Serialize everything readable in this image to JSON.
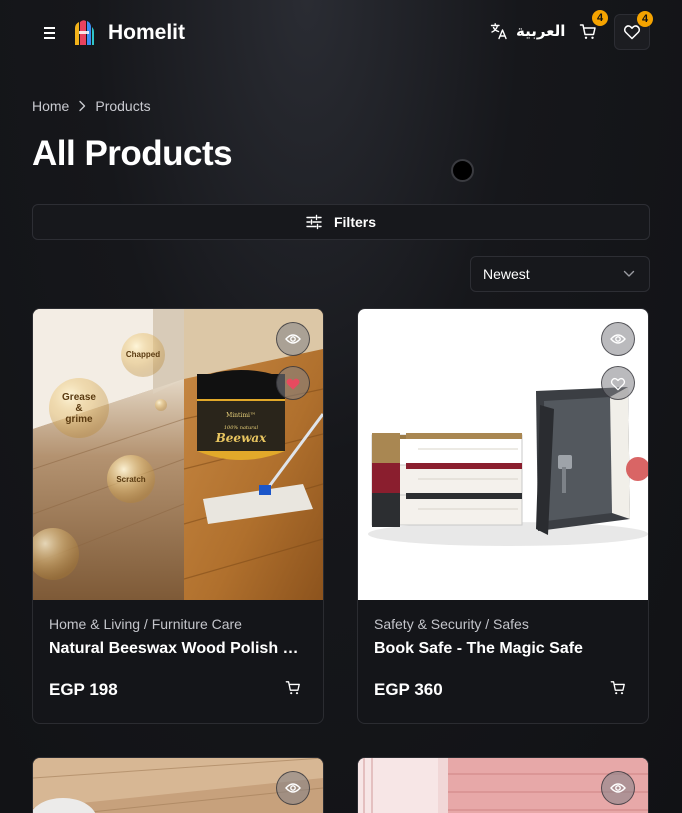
{
  "header": {
    "brand": "Homelit",
    "language_label": "العربية",
    "cart_count": "4",
    "wishlist_count": "4"
  },
  "breadcrumb": {
    "home": "Home",
    "current": "Products"
  },
  "page_title": "All Products",
  "filters_label": "Filters",
  "sort": {
    "selected": "Newest"
  },
  "products": [
    {
      "category": "Home & Living / Furniture Care",
      "name": "Natural Beeswax Wood Polish & Restorer",
      "price": "EGP 198",
      "wishlisted": true,
      "image_text": {
        "chapped": "Chapped",
        "grease_line1": "Grease",
        "grease_line2": "&",
        "grease_line3": "grime",
        "scratch": "Scratch",
        "jar_brand": "Mintimi™",
        "jar_sub": "100% natural",
        "jar_title": "Beewax"
      }
    },
    {
      "category": "Safety & Security / Safes",
      "name": "Book Safe - The Magic Safe",
      "price": "EGP 360",
      "wishlisted": false
    }
  ],
  "colors": {
    "accent_badge": "#f5a300",
    "wishlist_active": "#e84a5f",
    "background": "#131418"
  },
  "icons": [
    "menu-icon",
    "logo-icon",
    "translate-icon",
    "cart-icon",
    "heart-icon",
    "chevron-right-icon",
    "sliders-icon",
    "chevron-down-icon",
    "eye-icon"
  ]
}
